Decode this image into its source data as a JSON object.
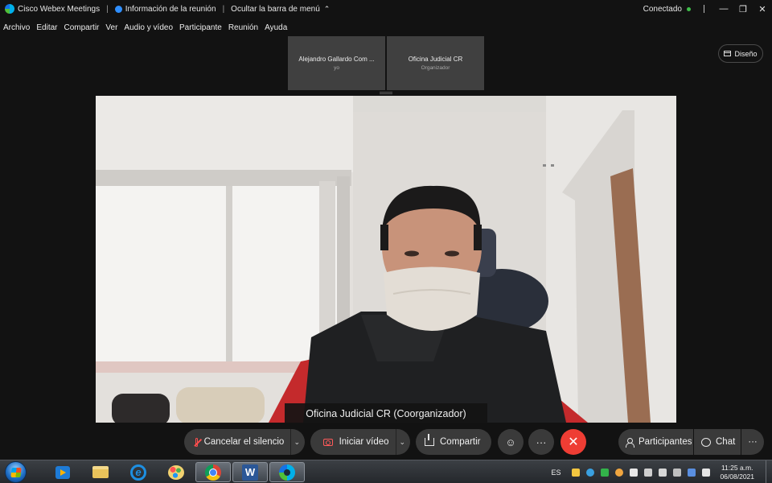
{
  "titlebar": {
    "app_name": "Cisco Webex Meetings",
    "meeting_info": "Información de la reunión",
    "hide_menu": "Ocultar la barra de menú",
    "status": "Conectado",
    "minimize": "—",
    "restore": "❐",
    "close": "✕"
  },
  "menu": {
    "items": [
      "Archivo",
      "Editar",
      "Compartir",
      "Ver",
      "Audio y vídeo",
      "Participante",
      "Reunión",
      "Ayuda"
    ]
  },
  "thumbnails": [
    {
      "name": "Alejandro Gallardo Com ...",
      "sub": "yo"
    },
    {
      "name": "Oficina Judicial CR",
      "sub": "Organizador"
    }
  ],
  "layout_button": "Diseño",
  "video": {
    "participant_label": "Oficina Judicial CR (Coorganizador)"
  },
  "controls": {
    "mute": "Cancelar el silencio",
    "start_video": "Iniciar vídeo",
    "share": "Compartir",
    "reactions": "☺",
    "more": "···",
    "end": "✕",
    "participants": "Participantes",
    "chat": "Chat",
    "panel_more": "···"
  },
  "taskbar": {
    "language": "ES",
    "time": "11:25 a.m.",
    "date": "06/08/2021"
  },
  "colors": {
    "background": "#121212",
    "pill": "#3a3a3a",
    "end_call": "#ee3d34",
    "muted_red": "#ff4d4d",
    "connected": "#3fbf4a"
  }
}
